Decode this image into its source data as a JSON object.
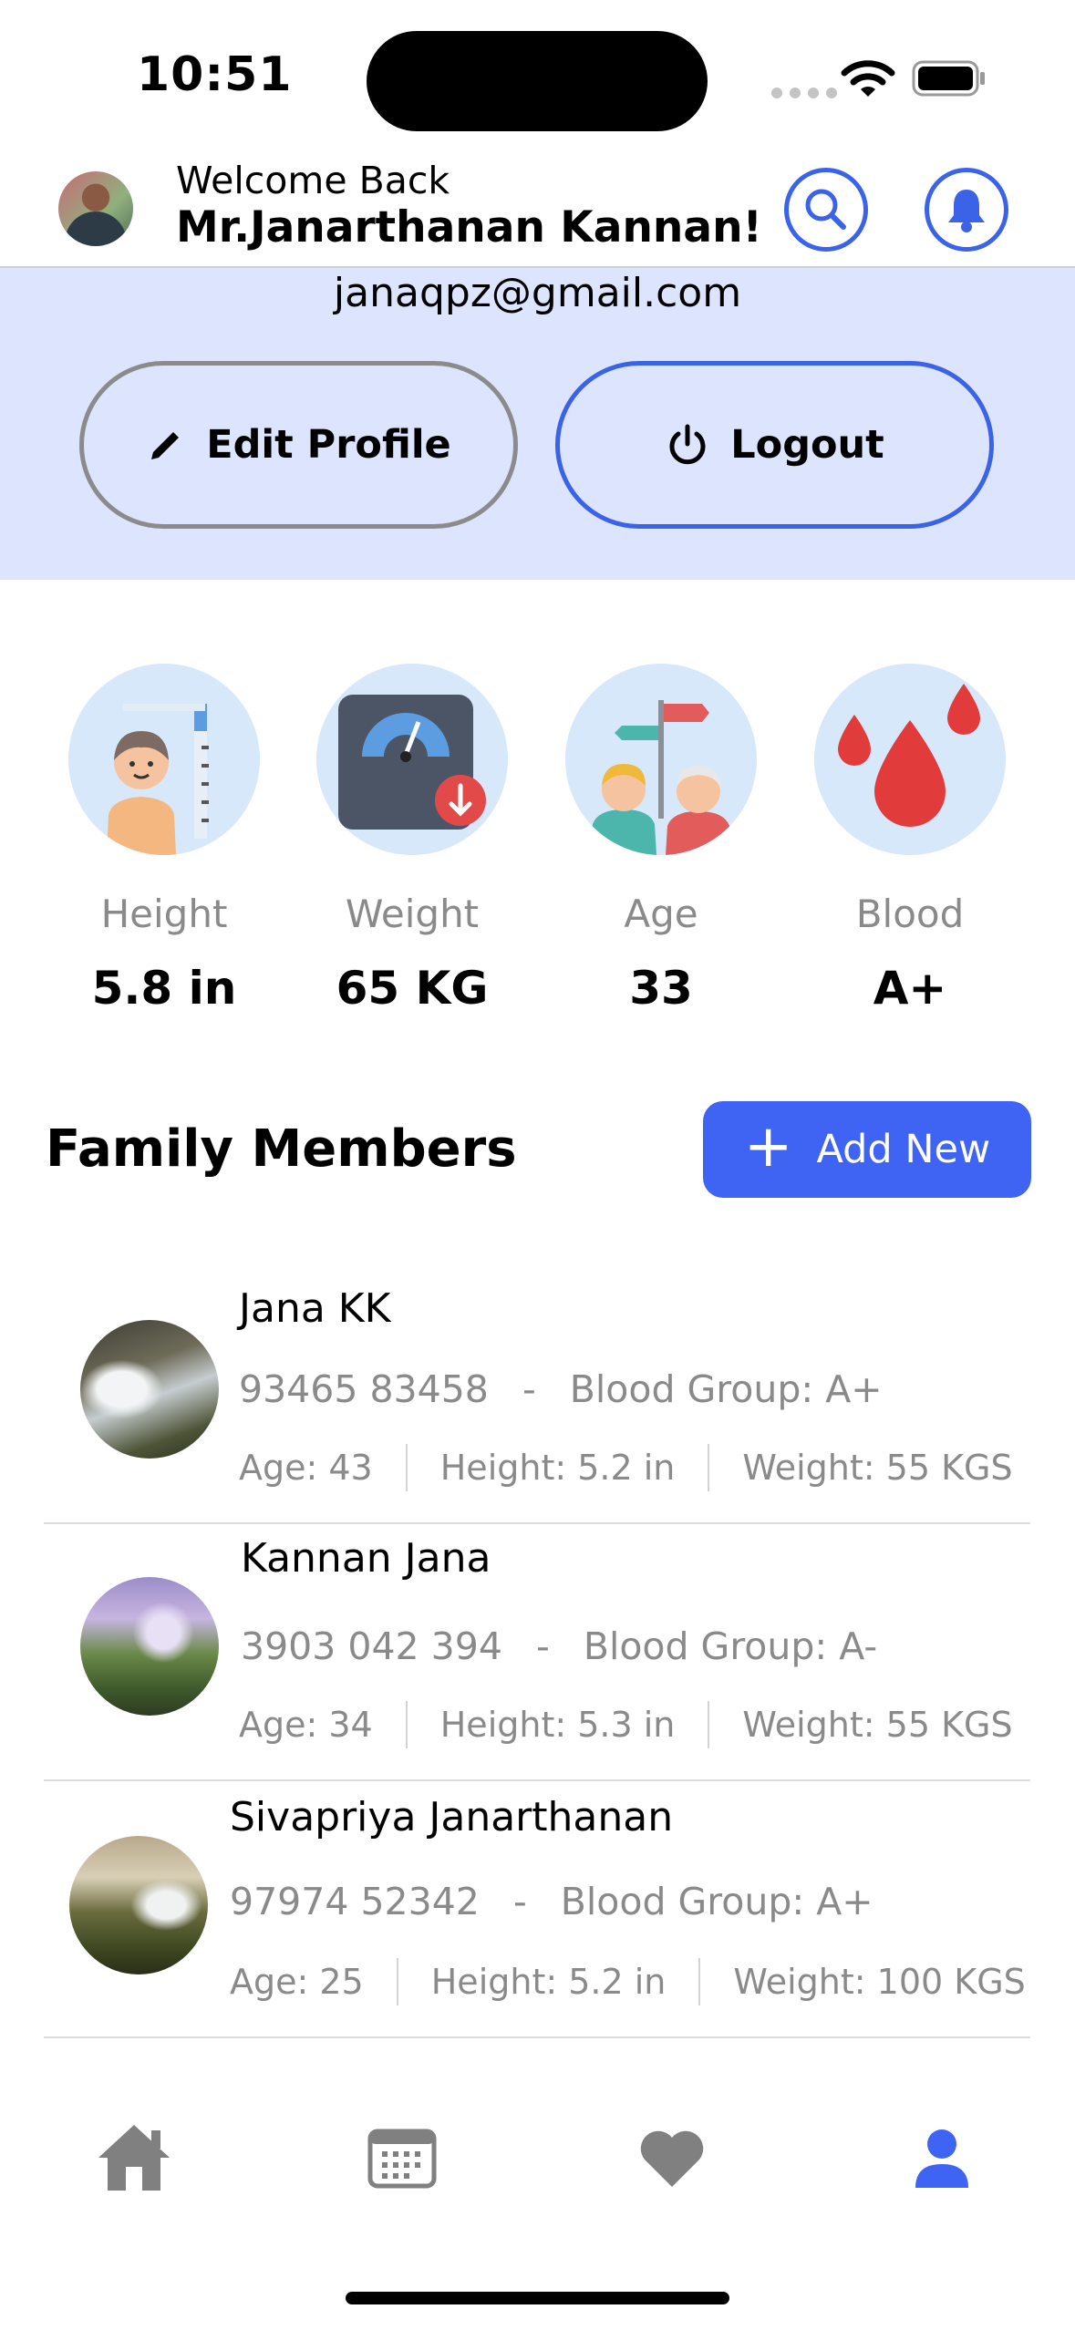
{
  "status_bar": {
    "time": "10:51"
  },
  "header": {
    "welcome": "Welcome Back",
    "user_name": "Mr.Janarthanan Kannan!",
    "avatar_icon": "user-avatar-photo",
    "search_icon": "search-icon",
    "bell_icon": "bell-icon"
  },
  "profile": {
    "email": "janaqpz@gmail.com",
    "edit_label": "Edit Profile",
    "logout_label": "Logout"
  },
  "stats": [
    {
      "label": "Height",
      "value": "5.8 in",
      "icon": "height-measure-icon"
    },
    {
      "label": "Weight",
      "value": "65 KG",
      "icon": "weight-scale-icon"
    },
    {
      "label": "Age",
      "value": "33",
      "icon": "age-icon"
    },
    {
      "label": "Blood",
      "value": "A+",
      "icon": "blood-drop-icon"
    }
  ],
  "family": {
    "title": "Family Members",
    "add_label": "Add New",
    "members": [
      {
        "name": "Jana KK",
        "phone": "93465 83458",
        "dash": "-",
        "blood": "Blood Group: A+",
        "age": "Age: 43",
        "height": "Height: 5.2 in",
        "weight": "Weight: 55 KGS"
      },
      {
        "name": "Kannan Jana",
        "phone": "3903 042 394",
        "dash": "-",
        "blood": "Blood Group: A-",
        "age": "Age: 34",
        "height": "Height: 5.3 in",
        "weight": "Weight: 55 KGS"
      },
      {
        "name": "Sivapriya Janarthanan",
        "phone": "97974 52342",
        "dash": "-",
        "blood": "Blood Group: A+",
        "age": "Age: 25",
        "height": "Height: 5.2 in",
        "weight": "Weight: 100 KGS"
      }
    ]
  },
  "nav": [
    {
      "name": "Home",
      "icon": "home-icon",
      "active": false
    },
    {
      "name": "Calendar",
      "icon": "calendar-icon",
      "active": false
    },
    {
      "name": "Favorites",
      "icon": "heart-icon",
      "active": false
    },
    {
      "name": "Profile",
      "icon": "person-icon",
      "active": true
    }
  ],
  "colors": {
    "accent": "#3f64f4",
    "band": "#dde4fd",
    "muted_text": "#8a8a8a",
    "icon_circle": "#d7e8fb"
  }
}
